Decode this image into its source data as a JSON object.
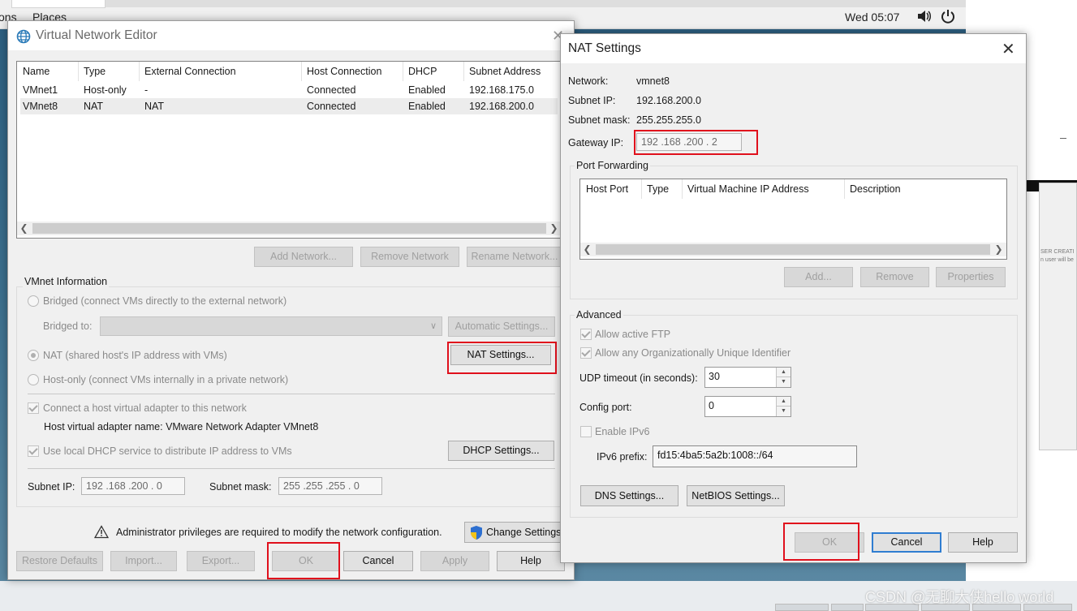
{
  "desktop": {
    "menu_items": [
      "ons",
      "Places"
    ],
    "clock": "Wed 05:07",
    "card_text": "SER CREATI\nn user will be",
    "watermark": "CSDN @无聊大侠hello world"
  },
  "vne": {
    "title": "Virtual Network Editor",
    "columns": [
      "Name",
      "Type",
      "External Connection",
      "Host Connection",
      "DHCP",
      "Subnet Address"
    ],
    "rows": [
      [
        "VMnet1",
        "Host-only",
        "-",
        "Connected",
        "Enabled",
        "192.168.175.0"
      ],
      [
        "VMnet8",
        "NAT",
        "NAT",
        "Connected",
        "Enabled",
        "192.168.200.0"
      ]
    ],
    "buttons": {
      "add_network": "Add Network...",
      "remove_network": "Remove Network",
      "rename_network": "Rename Network...",
      "automatic_settings": "Automatic Settings...",
      "nat_settings": "NAT Settings...",
      "dhcp_settings": "DHCP Settings...",
      "change_settings": "Change Settings",
      "restore_defaults": "Restore Defaults",
      "import": "Import...",
      "export": "Export...",
      "ok": "OK",
      "cancel": "Cancel",
      "apply": "Apply",
      "help": "Help"
    },
    "vmnet_info": {
      "label": "VMnet Information",
      "bridged": "Bridged (connect VMs directly to the external network)",
      "bridged_to": "Bridged to:",
      "nat": "NAT (shared host's IP address with VMs)",
      "host_only": "Host-only (connect VMs internally in a private network)",
      "connect_adapter": "Connect a host virtual adapter to this network",
      "adapter_name": "Host virtual adapter name: VMware Network Adapter VMnet8",
      "use_dhcp": "Use local DHCP service to distribute IP address to VMs",
      "subnet_ip_label": "Subnet IP:",
      "subnet_ip": "192 .168 .200 .  0",
      "subnet_mask_label": "Subnet mask:",
      "subnet_mask": "255 .255 .255 .  0"
    },
    "admin_notice": "Administrator privileges are required to modify the network configuration."
  },
  "nat": {
    "title": "NAT Settings",
    "network_label": "Network:",
    "network": "vmnet8",
    "subnet_ip_label": "Subnet IP:",
    "subnet_ip": "192.168.200.0",
    "subnet_mask_label": "Subnet mask:",
    "subnet_mask": "255.255.255.0",
    "gateway_label": "Gateway IP:",
    "gateway": "192 .168 .200 .  2",
    "port_forwarding": {
      "label": "Port Forwarding",
      "columns": [
        "Host Port",
        "Type",
        "Virtual Machine IP Address",
        "Description"
      ],
      "add": "Add...",
      "remove": "Remove",
      "properties": "Properties"
    },
    "advanced": {
      "label": "Advanced",
      "allow_ftp": "Allow active FTP",
      "allow_oui": "Allow any Organizationally Unique Identifier",
      "udp_label": "UDP timeout (in seconds):",
      "udp_value": "30",
      "config_port_label": "Config port:",
      "config_port_value": "0",
      "enable_ipv6": "Enable IPv6",
      "ipv6_label": "IPv6 prefix:",
      "ipv6_value": "fd15:4ba5:5a2b:1008::/64",
      "dns": "DNS Settings...",
      "netbios": "NetBIOS Settings..."
    },
    "ok": "OK",
    "cancel": "Cancel",
    "help": "Help"
  }
}
